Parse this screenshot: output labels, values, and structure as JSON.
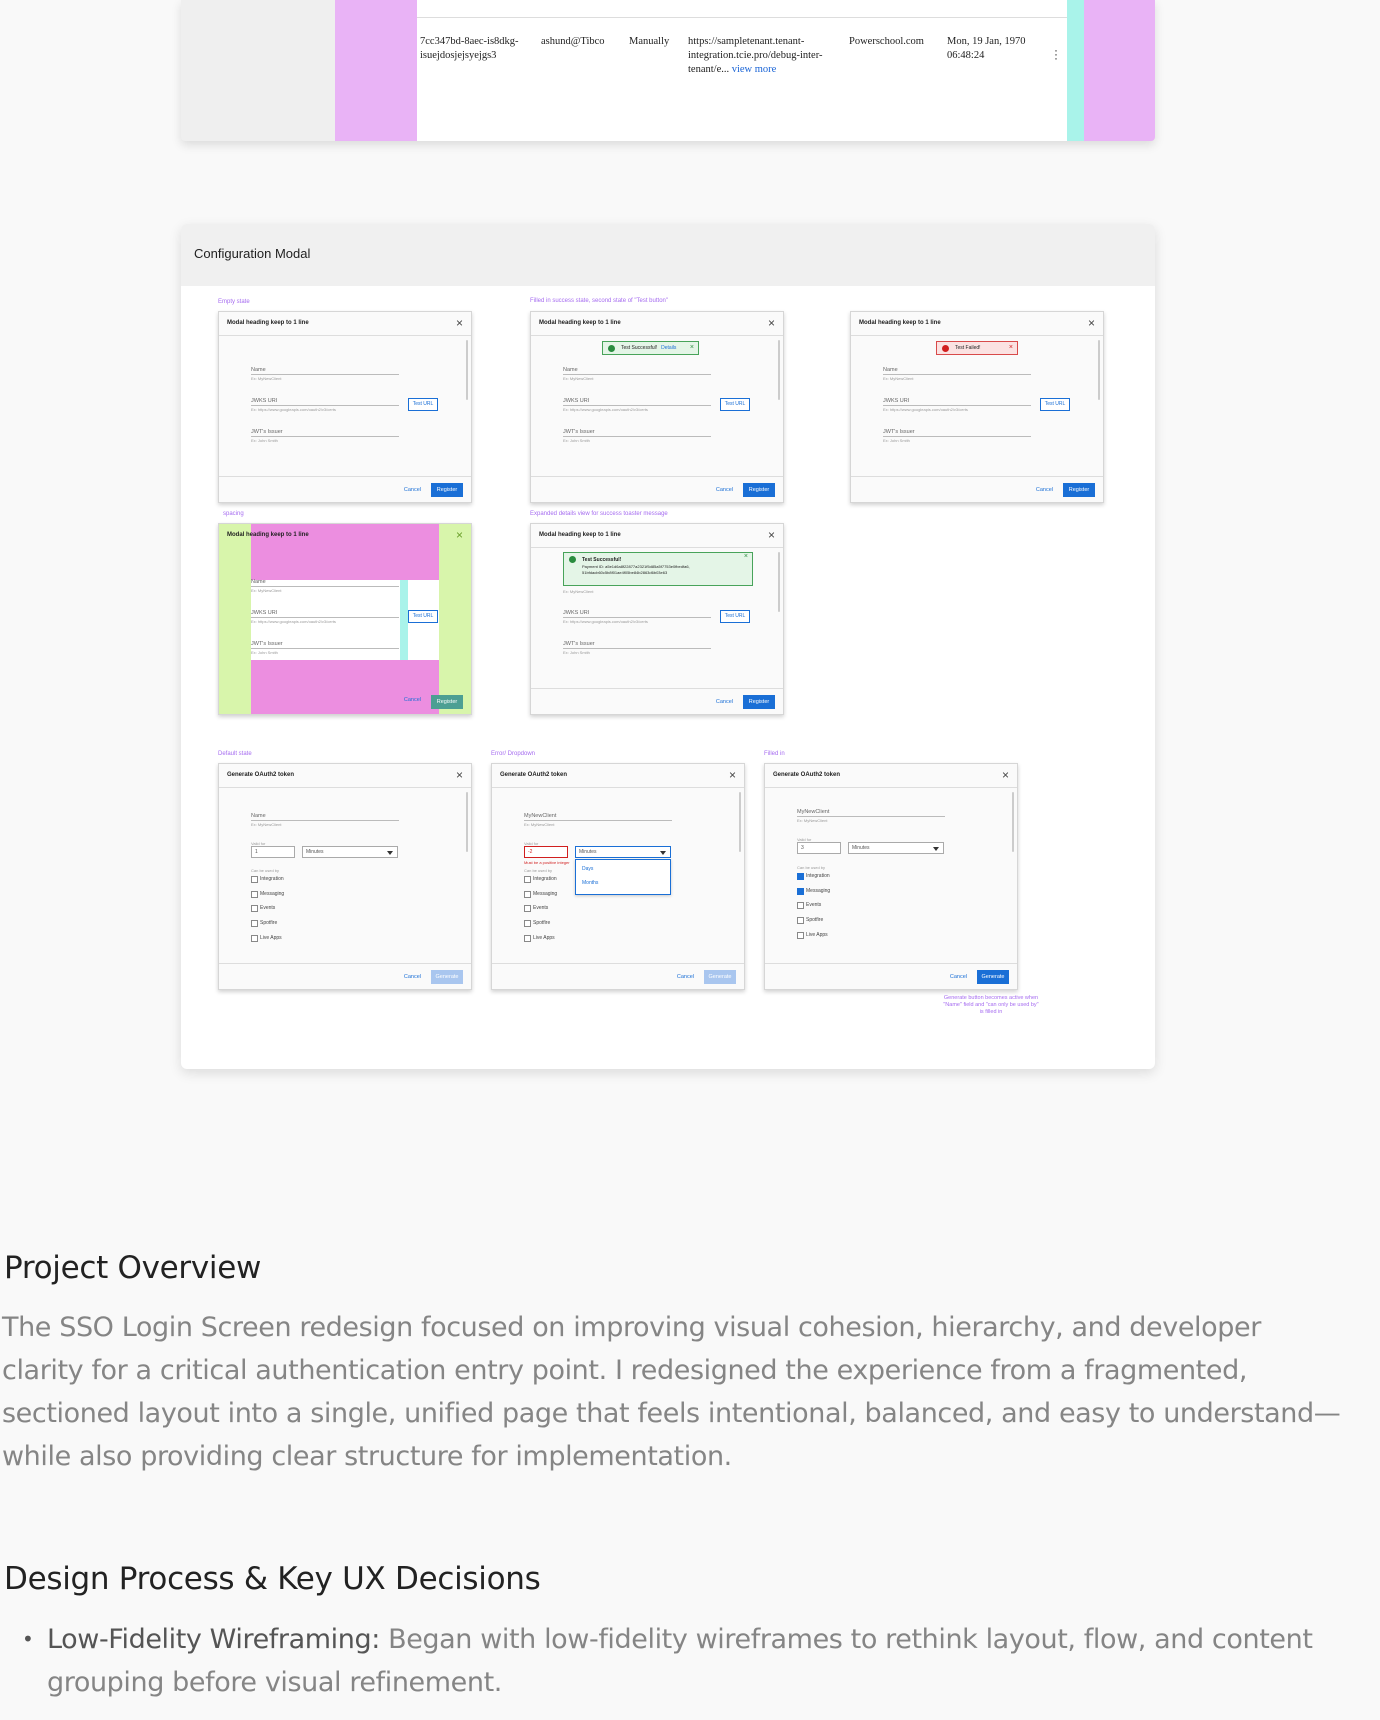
{
  "table_row": {
    "id": "7cc347bd-8aec-is8dkg-isuejdosjejsyejgs3",
    "user": "ashund@Tibco",
    "method": "Manually",
    "url": "https://sampletenant.tenant-integration.tcie.pro/debug-inter-tenant/e...",
    "view_more": "view more",
    "domain": "Powerschool.com",
    "date": "Mon, 19 Jan, 1970 06:48:24"
  },
  "config": {
    "title": "Configuration Modal",
    "labels": {
      "empty": "Empty state",
      "filled_success": "Filled in success state, second state of \"Test button\"",
      "spacing": "spacing",
      "expanded": "Expanded details view for success toaster message",
      "default": "Default state",
      "error_dropdown": "Error/ Dropdown",
      "filled_in": "Filled in",
      "generate_note": "Generate button becomes active when \"Name\" field and \"can only be used by\" is filled in"
    },
    "register_modal": {
      "heading": "Modal heading keep to 1 line",
      "name_label": "Name",
      "name_hint": "Ex: MyNewClient",
      "jwks_label": "JWKS URI",
      "jwks_hint": "Ex: https://www.googleapis.com/oauth2/v3/certs",
      "issuer_label": "JWT's Issuer",
      "issuer_hint": "Ex: John Smith",
      "test_url": "Test URL",
      "cancel": "Cancel",
      "register": "Register",
      "success": "Test Successful!",
      "details": "Details",
      "failed": "Test Failed!",
      "success_detail": "Payment ID: a5e1d6a8f22877a2321f5d85a5f7753e0fbedfa6, 51bfdacb60c5b8f01ae4f05be84b2863d6b03e63"
    },
    "generate_modal": {
      "heading": "Generate OAuth2 token",
      "name_label": "Name",
      "name_hint": "Ex: MyNewClient",
      "name_value": "MyNewClient",
      "valid_label": "Valid for",
      "valid_value_default": "1",
      "valid_value_error": "-2",
      "valid_value_filled": "3",
      "unit": "Minutes",
      "error_text": "Must be a positive integer",
      "used_by_label": "Can be used by",
      "options": [
        "Integration",
        "Messaging",
        "Events",
        "Spotfire",
        "Live Apps"
      ],
      "dropdown_options": [
        "Days",
        "Months"
      ],
      "cancel": "Cancel",
      "generate": "Generate"
    }
  },
  "overview": {
    "heading": "Project Overview",
    "body": "The SSO Login Screen redesign focused on improving visual cohesion, hierarchy, and developer clarity for a critical authentication entry point. I redesigned the experience from a fragmented, sectioned layout into a single, unified page that feels intentional, balanced, and easy to understand—while also providing clear structure for implementation."
  },
  "process": {
    "heading": "Design Process & Key UX Decisions",
    "bullets": [
      {
        "title": "Low-Fidelity Wireframing:",
        "text": " Began with low-fidelity wireframes to rethink layout, flow, and content grouping before visual refinement."
      }
    ]
  },
  "colors": {
    "magenta_overlay": "#e9b3f6",
    "cyan_overlay": "#a9f3ea",
    "primary_blue": "#1a6fd6",
    "annotation_purple": "#a66cf0"
  }
}
